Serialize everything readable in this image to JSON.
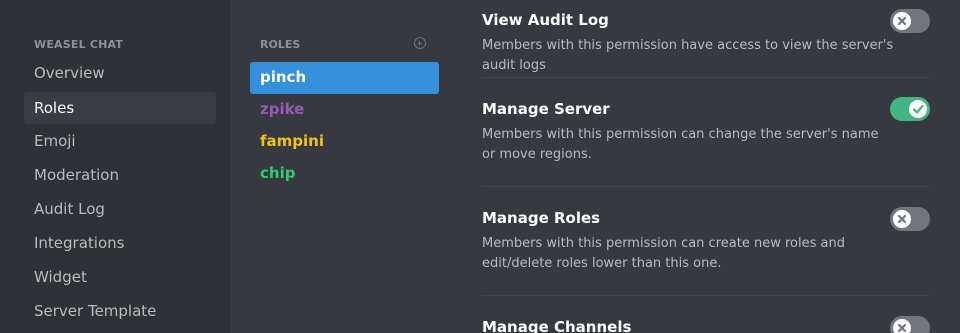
{
  "sidebar": {
    "header": "WEASEL CHAT",
    "items": [
      {
        "label": "Overview"
      },
      {
        "label": "Roles"
      },
      {
        "label": "Emoji"
      },
      {
        "label": "Moderation"
      },
      {
        "label": "Audit Log"
      },
      {
        "label": "Integrations"
      },
      {
        "label": "Widget"
      },
      {
        "label": "Server Template"
      }
    ],
    "active_item": "Roles"
  },
  "roles": {
    "header": "ROLES",
    "add_icon": "plus-circle-icon",
    "items": [
      {
        "name": "pinch",
        "color": "#ffffff"
      },
      {
        "name": "zpike",
        "color": "#9b59b6"
      },
      {
        "name": "fampini",
        "color": "#f1c40f"
      },
      {
        "name": "chip",
        "color": "#2ecc71"
      }
    ],
    "selected": "pinch"
  },
  "permissions": [
    {
      "title": "View Audit Log",
      "description": "Members with this permission have access to view the server's audit logs",
      "enabled": false
    },
    {
      "title": "Manage Server",
      "description": "Members with this permission can change the server's name or move regions.",
      "enabled": true
    },
    {
      "title": "Manage Roles",
      "description": "Members with this permission can create new roles and edit/delete roles lower than this one.",
      "enabled": false
    },
    {
      "title": "Manage Channels",
      "description": "",
      "enabled": false
    }
  ],
  "colors": {
    "sidebar_bg": "#2f3136",
    "main_bg": "#36393f",
    "selected_role_bg": "#3591dc",
    "toggle_on": "#43b581",
    "toggle_off": "#72767d"
  }
}
